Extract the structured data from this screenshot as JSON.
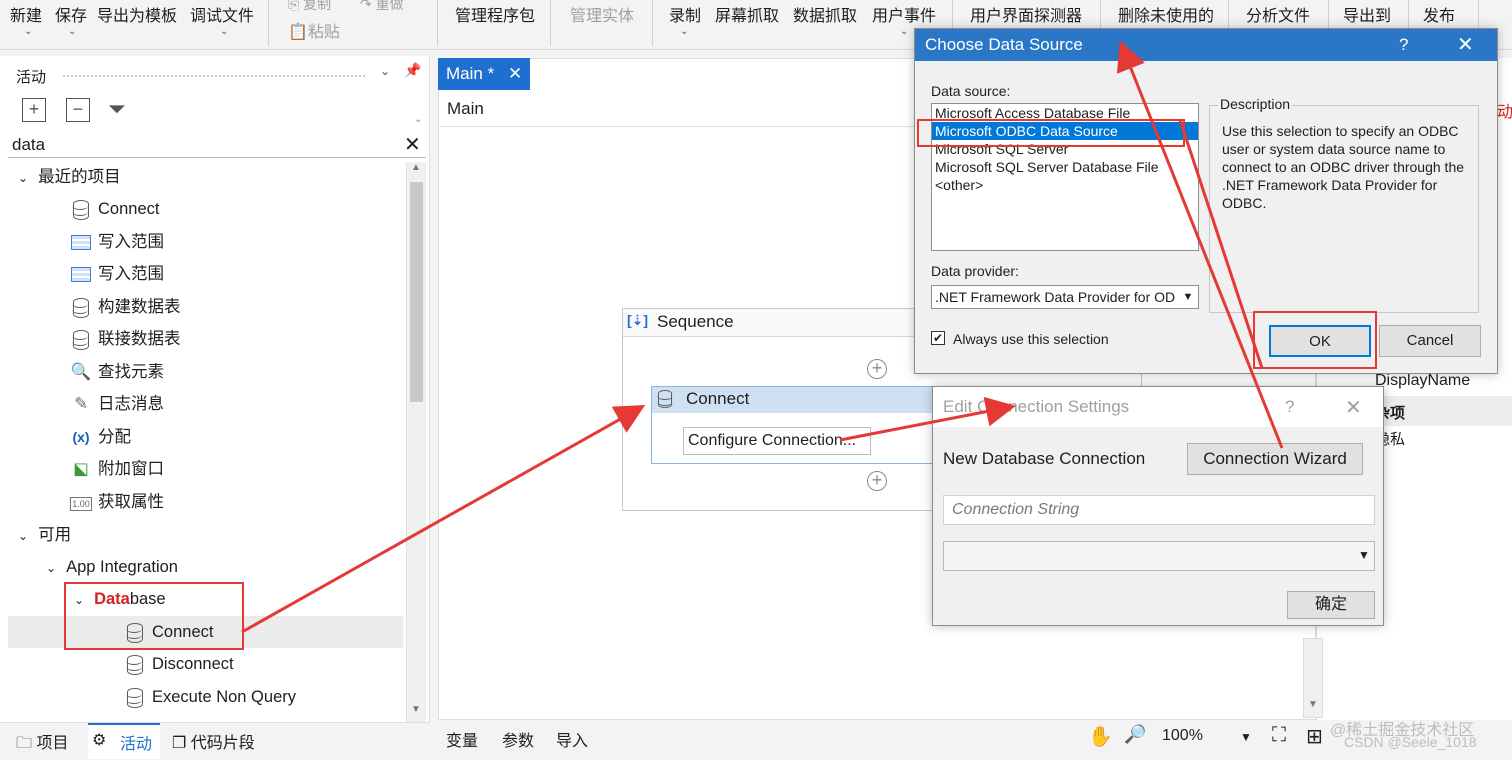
{
  "ribbon": {
    "new": "新建",
    "save": "保存",
    "export_template": "导出为模板",
    "debug_file": "调试文件",
    "copy": "复制",
    "paste": "粘贴",
    "redo": "重做",
    "manage_packages": "管理程序包",
    "manage_entities": "管理实体",
    "record": "录制",
    "screen_scraping": "屏幕抓取",
    "data_scraping": "数据抓取",
    "user_events": "用户事件",
    "ui_explorer": "用户界面探测器",
    "remove_unused": "删除未使用的",
    "analyze_file": "分析文件",
    "export_to": "导出到",
    "publish": "发布"
  },
  "activities": {
    "title": "活动",
    "search_value": "data",
    "recent_header": "最近的项目",
    "recent": [
      "Connect",
      "写入范围",
      "写入范围",
      "构建数据表",
      "联接数据表",
      "查找元素",
      "日志消息",
      "分配",
      "附加窗口",
      "获取属性"
    ],
    "available_header": "可用",
    "app_integration": "App Integration",
    "database_match": "Data",
    "database_rest": "base",
    "database_items": [
      "Connect",
      "Disconnect",
      "Execute Non Query"
    ]
  },
  "designer": {
    "tab_label": "Main *",
    "breadcrumb": "Main",
    "sequence_title": "Sequence",
    "connect_title": "Connect",
    "configure_button": "Configure Connection..."
  },
  "right_partial": {
    "display_name": "DisplayName",
    "item_a": "杂项",
    "item_b": "隐私"
  },
  "choose_ds": {
    "title": "Choose Data Source",
    "help": "?",
    "data_source_label": "Data source:",
    "sources": [
      "Microsoft Access Database File",
      "Microsoft ODBC Data Source",
      "Microsoft SQL Server",
      "Microsoft SQL Server Database File",
      "<other>"
    ],
    "selected_index": 1,
    "description_label": "Description",
    "description_text": "Use this selection to specify an ODBC user or system data source name to connect to an ODBC driver through the .NET Framework Data Provider for ODBC.",
    "provider_label": "Data provider:",
    "provider_value": ".NET Framework Data Provider for OD",
    "always_use": "Always use this selection",
    "ok": "OK",
    "cancel": "Cancel"
  },
  "edit_conn": {
    "title": "Edit Connection Settings",
    "help": "?",
    "new_db_label": "New Database Connection",
    "wizard_button": "Connection Wizard",
    "conn_string_placeholder": "Connection String",
    "confirm": "确定"
  },
  "bottom": {
    "project_tab": "项目",
    "activities_tab": "活动",
    "snippets_tab": "代码片段",
    "variables": "变量",
    "arguments": "参数",
    "imports": "导入",
    "zoom": "100%"
  },
  "watermark": {
    "line1": "@稀土掘金技术社区",
    "line2": "CSDN @Seele_1018"
  },
  "colors": {
    "accent": "#1e6fd0",
    "selection": "#0078d7",
    "highlight": "#e53935",
    "dialog_title": "#2a77c8"
  }
}
